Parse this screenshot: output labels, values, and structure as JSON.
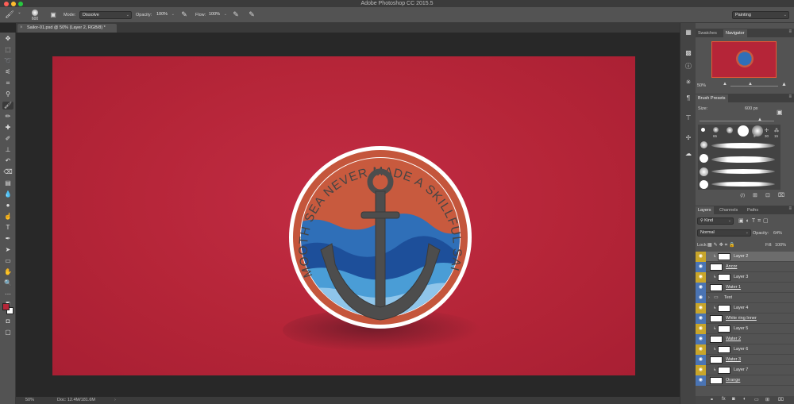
{
  "window": {
    "title": "Adobe Photoshop CC 2015.5"
  },
  "options": {
    "brush_size": "600",
    "mode_label": "Mode:",
    "mode_value": "Dissolve",
    "opacity_label": "Opacity:",
    "opacity_value": "100%",
    "flow_label": "Flow:",
    "flow_value": "100%",
    "workspace": "Painting"
  },
  "document": {
    "tab_label": "Sailor-01.psd @ 50% (Layer 2, RGB/8) *"
  },
  "artwork": {
    "badge_text": "A SMOOTH SEA NEVER MADE A SKILLFUL SAILOR"
  },
  "status": {
    "zoom": "50%",
    "doc_info": "Doc: 12.4M/181.6M"
  },
  "navigator": {
    "tabs": [
      "Swatches",
      "Navigator"
    ],
    "zoom": "50%"
  },
  "brush_presets": {
    "title": "Brush Presets",
    "size_label": "Size:",
    "size_value": "600 px",
    "sizes": [
      "65",
      "9",
      "30",
      "15"
    ]
  },
  "layers_panel": {
    "tabs": [
      "Layers",
      "Channels",
      "Paths"
    ],
    "filter": "Kind",
    "blend_mode": "Normal",
    "opacity_label": "Opacity:",
    "opacity_value": "64%",
    "lock_label": "Lock:",
    "fill_label": "Fill:",
    "fill_value": "100%",
    "layers": [
      {
        "name": "Layer 2",
        "selected": true,
        "linked": true
      },
      {
        "name": "Ancor",
        "selected": false,
        "linked": false
      },
      {
        "name": "Layer 3",
        "selected": false,
        "linked": true
      },
      {
        "name": "Water 1",
        "selected": false,
        "linked": false
      },
      {
        "name": "Text",
        "selected": false,
        "linked": false
      },
      {
        "name": "Layer 4",
        "selected": false,
        "linked": true
      },
      {
        "name": "White ring Inner",
        "selected": false,
        "linked": false
      },
      {
        "name": "Layer 5",
        "selected": false,
        "linked": true
      },
      {
        "name": "Water 2",
        "selected": false,
        "linked": false
      },
      {
        "name": "Layer 6",
        "selected": false,
        "linked": true
      },
      {
        "name": "Water 3",
        "selected": false,
        "linked": false
      },
      {
        "name": "Layer 7",
        "selected": false,
        "linked": true
      },
      {
        "name": "Orange",
        "selected": false,
        "linked": false
      }
    ]
  },
  "colors": {
    "foreground": "#b52538",
    "background": "#ffffff",
    "canvas_red": "#b52538",
    "eye_yellow": "#c8a52a",
    "eye_blue": "#4a74b4"
  }
}
